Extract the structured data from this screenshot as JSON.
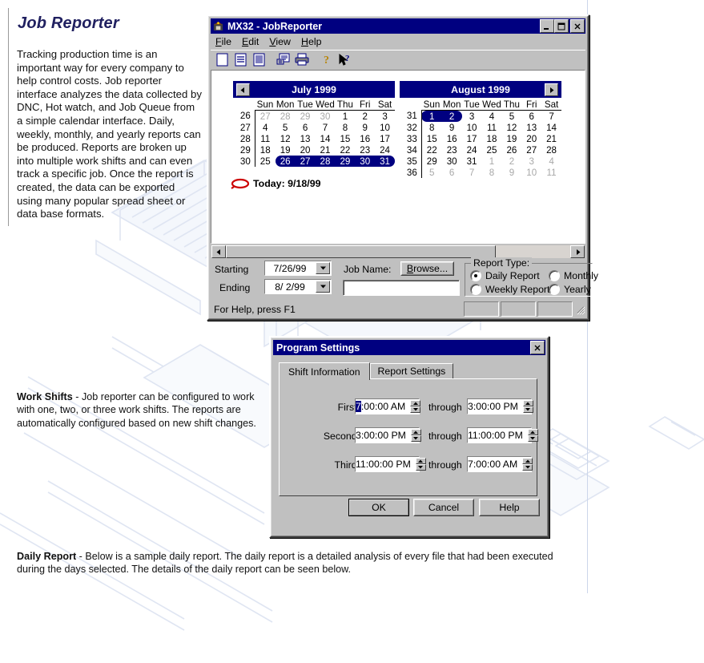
{
  "article": {
    "title": "Job Reporter",
    "intro": "Tracking production time is an important way for every company to help control costs.            Job reporter interface analyzes the data collected by DNC, Hot watch, and Job Queue from a simple calendar interface. Daily, weekly, monthly, and yearly reports can be produced. Reports are broken up into multiple work shifts and can even track a specific job. Once the report is created, the data can be exported using many popular spread sheet or data base formats.",
    "work_shifts_lead": "Work Shifts",
    "work_shifts_body": " - Job reporter can be configured to work with one, two, or three work shifts. The reports are automatically configured based on new shift changes.",
    "daily_report_lead": "Daily Report",
    "daily_report_body": " - Below is a sample daily report. The daily report is a detailed analysis of every file that had been executed during the days selected. The details of the daily report can be seen below."
  },
  "main_window": {
    "title": "MX32 - JobReporter",
    "icon": "app-icon",
    "minimize_glyph": "_",
    "maximize_glyph": "□",
    "close_glyph": "✕",
    "menu": [
      {
        "label": "File",
        "accel": "F"
      },
      {
        "label": "Edit",
        "accel": "E"
      },
      {
        "label": "View",
        "accel": "V"
      },
      {
        "label": "Help",
        "accel": "H"
      }
    ],
    "toolbar": [
      {
        "name": "new-document-icon"
      },
      {
        "name": "open-document-icon"
      },
      {
        "name": "report-document-icon"
      },
      {
        "name": "print-preview-icon"
      },
      {
        "name": "print-icon"
      },
      {
        "name": "help-icon"
      },
      {
        "name": "context-help-icon"
      }
    ],
    "status_text": "For Help, press F1",
    "colors": {
      "titlebar": "#000080",
      "face": "#c0c0c0",
      "selection": "#000080",
      "today_mark": "#cc0000"
    }
  },
  "calendar": {
    "prev_glyph": "◄",
    "next_glyph": "►",
    "dow": [
      "Sun",
      "Mon",
      "Tue",
      "Wed",
      "Thu",
      "Fri",
      "Sat"
    ],
    "today_label": "Today:  9/18/99",
    "months": [
      {
        "title": "July 1999",
        "has_prev": true,
        "has_next": false,
        "weeks": [
          {
            "num": "26",
            "days": [
              {
                "d": "27",
                "other": true
              },
              {
                "d": "28",
                "other": true
              },
              {
                "d": "29",
                "other": true
              },
              {
                "d": "30",
                "other": true
              },
              {
                "d": "1"
              },
              {
                "d": "2"
              },
              {
                "d": "3"
              }
            ]
          },
          {
            "num": "27",
            "days": [
              {
                "d": "4"
              },
              {
                "d": "5"
              },
              {
                "d": "6"
              },
              {
                "d": "7"
              },
              {
                "d": "8"
              },
              {
                "d": "9"
              },
              {
                "d": "10"
              }
            ]
          },
          {
            "num": "28",
            "days": [
              {
                "d": "11"
              },
              {
                "d": "12"
              },
              {
                "d": "13"
              },
              {
                "d": "14"
              },
              {
                "d": "15"
              },
              {
                "d": "16"
              },
              {
                "d": "17"
              }
            ]
          },
          {
            "num": "29",
            "days": [
              {
                "d": "18"
              },
              {
                "d": "19"
              },
              {
                "d": "20"
              },
              {
                "d": "21"
              },
              {
                "d": "22"
              },
              {
                "d": "23"
              },
              {
                "d": "24"
              }
            ]
          },
          {
            "num": "30",
            "days": [
              {
                "d": "25"
              },
              {
                "d": "26",
                "sel": true,
                "selFirst": true
              },
              {
                "d": "27",
                "sel": true
              },
              {
                "d": "28",
                "sel": true
              },
              {
                "d": "29",
                "sel": true
              },
              {
                "d": "30",
                "sel": true
              },
              {
                "d": "31",
                "sel": true,
                "selLast": true
              }
            ]
          }
        ]
      },
      {
        "title": "August 1999",
        "has_prev": false,
        "has_next": true,
        "weeks": [
          {
            "num": "31",
            "days": [
              {
                "d": "1",
                "sel": true,
                "selFirst": true
              },
              {
                "d": "2",
                "sel": true,
                "selLast": true
              },
              {
                "d": "3"
              },
              {
                "d": "4"
              },
              {
                "d": "5"
              },
              {
                "d": "6"
              },
              {
                "d": "7"
              }
            ]
          },
          {
            "num": "32",
            "days": [
              {
                "d": "8"
              },
              {
                "d": "9"
              },
              {
                "d": "10"
              },
              {
                "d": "11"
              },
              {
                "d": "12"
              },
              {
                "d": "13"
              },
              {
                "d": "14"
              }
            ]
          },
          {
            "num": "33",
            "days": [
              {
                "d": "15"
              },
              {
                "d": "16"
              },
              {
                "d": "17"
              },
              {
                "d": "18"
              },
              {
                "d": "19"
              },
              {
                "d": "20"
              },
              {
                "d": "21"
              }
            ]
          },
          {
            "num": "34",
            "days": [
              {
                "d": "22"
              },
              {
                "d": "23"
              },
              {
                "d": "24"
              },
              {
                "d": "25"
              },
              {
                "d": "26"
              },
              {
                "d": "27"
              },
              {
                "d": "28"
              }
            ]
          },
          {
            "num": "35",
            "days": [
              {
                "d": "29"
              },
              {
                "d": "30"
              },
              {
                "d": "31"
              },
              {
                "d": "1",
                "other": true
              },
              {
                "d": "2",
                "other": true
              },
              {
                "d": "3",
                "other": true
              },
              {
                "d": "4",
                "other": true
              }
            ]
          },
          {
            "num": "36",
            "days": [
              {
                "d": "5",
                "other": true
              },
              {
                "d": "6",
                "other": true
              },
              {
                "d": "7",
                "other": true
              },
              {
                "d": "8",
                "other": true
              },
              {
                "d": "9",
                "other": true
              },
              {
                "d": "10",
                "other": true
              },
              {
                "d": "11",
                "other": true
              }
            ]
          }
        ]
      }
    ]
  },
  "controls": {
    "starting_label": "Starting",
    "starting_value": "7/26/99",
    "ending_label": "Ending",
    "ending_value": "8/ 2/99",
    "job_name_label": "Job Name:",
    "browse_label": "Browse...",
    "browse_accel": "B",
    "job_name_value": "",
    "report_type_label": "Report Type:",
    "report_types": [
      {
        "label": "Daily Report",
        "selected": true
      },
      {
        "label": "Weekly Report",
        "selected": false
      },
      {
        "label": "Monthly",
        "selected": false
      },
      {
        "label": "Yearly",
        "selected": false
      }
    ]
  },
  "settings_dialog": {
    "title": "Program Settings",
    "close_glyph": "✕",
    "tabs": [
      {
        "label": "Shift Information",
        "active": true
      },
      {
        "label": "Report Settings",
        "active": false
      }
    ],
    "through_label": "through",
    "shifts": [
      {
        "label": "First Shift:",
        "start_hl": "7",
        "start_rest": ":00:00 AM",
        "end": "3:00:00 PM"
      },
      {
        "label": "Second Shift:",
        "start_hl": "",
        "start_rest": "3:00:00 PM",
        "end": "11:00:00 PM"
      },
      {
        "label": "Third Shift:",
        "start_hl": "",
        "start_rest": "11:00:00 PM",
        "end": "7:00:00 AM"
      }
    ],
    "buttons": [
      {
        "label": "OK",
        "default": true
      },
      {
        "label": "Cancel",
        "default": false
      },
      {
        "label": "Help",
        "default": false
      }
    ]
  }
}
